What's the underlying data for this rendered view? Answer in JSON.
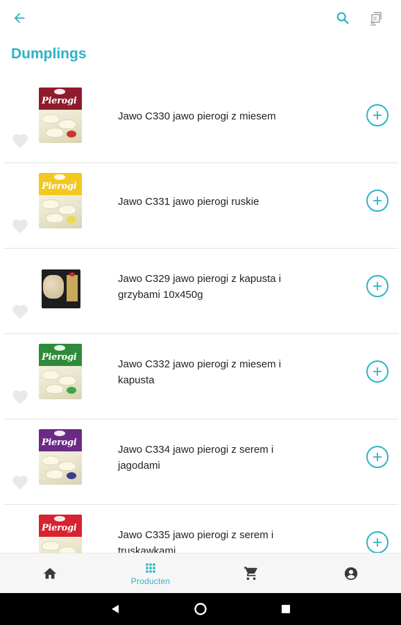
{
  "header": {
    "back_icon": "arrow-left-icon",
    "search_icon": "search-icon",
    "scan_icon": "scan-icon"
  },
  "page_title": "Dumplings",
  "accent_color": "#2bb3c6",
  "products": [
    {
      "title": "Jawo C330 jawo pierogi z miesem",
      "pack": "Pierogi",
      "pack_color": "#8e1b2c",
      "garnish": "#c83a2a"
    },
    {
      "title": "Jawo C331 jawo pierogi ruskie",
      "pack": "Pierogi",
      "pack_color": "#f2c81f",
      "garnish": "#f0d64a"
    },
    {
      "title": "Jawo C329 jawo pierogi z kapusta i grzybami 10x450g",
      "pack": "",
      "pack_color": "#1e1e1e",
      "garnish": "#c9a95a"
    },
    {
      "title": "Jawo C332 jawo pierogi z miesem i kapusta",
      "pack": "Pierogi",
      "pack_color": "#2e8b3a",
      "garnish": "#3aa84a"
    },
    {
      "title": "Jawo C334 jawo pierogi z serem i jagodami",
      "pack": "Pierogi",
      "pack_color": "#6b2a86",
      "garnish": "#3b3f8f"
    },
    {
      "title": "Jawo C335 jawo pierogi z serem i truskawkami",
      "pack": "Pierogi",
      "pack_color": "#d7232f",
      "garnish": "#d7232f"
    }
  ],
  "nav": {
    "home_icon": "home-icon",
    "products_icon": "grid-icon",
    "products_label": "Producten",
    "cart_icon": "cart-icon",
    "account_icon": "account-icon"
  },
  "system": {
    "back": "back-triangle-icon",
    "home": "home-circle-icon",
    "recents": "recents-square-icon"
  }
}
